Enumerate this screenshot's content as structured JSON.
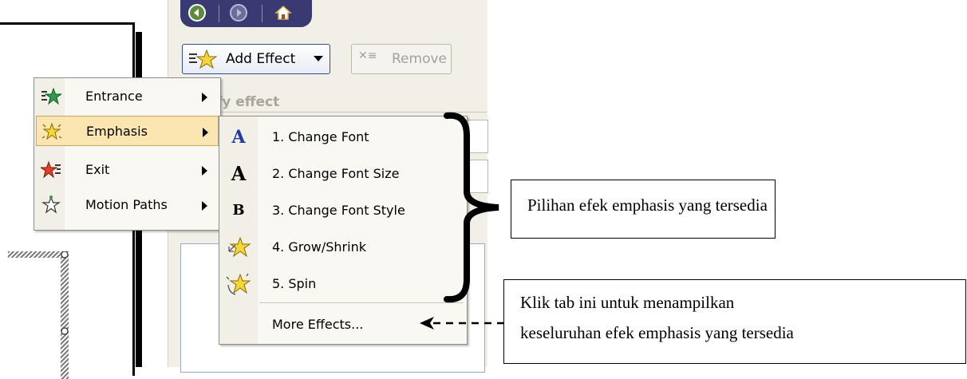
{
  "nav": {
    "back_icon": "back-arrow-icon",
    "forward_icon": "forward-arrow-icon",
    "home_icon": "home-icon"
  },
  "toolbar": {
    "add_effect_label": "Add Effect",
    "remove_label": "Remove"
  },
  "section": {
    "modify_effect_label": "ify effect"
  },
  "menu_main": {
    "items": [
      {
        "label": "Entrance",
        "icon": "entrance-star-icon"
      },
      {
        "label": "Emphasis",
        "icon": "emphasis-star-icon"
      },
      {
        "label": "Exit",
        "icon": "exit-star-icon"
      },
      {
        "label": "Motion Paths",
        "icon": "motion-paths-star-icon"
      }
    ]
  },
  "menu_emphasis": {
    "items": [
      {
        "label": "1. Change Font",
        "icon": "A"
      },
      {
        "label": "2. Change Font Size",
        "icon": "A"
      },
      {
        "label": "3. Change Font Style",
        "icon": "B"
      },
      {
        "label": "4. Grow/Shrink",
        "icon": "grow-shrink-star-icon"
      },
      {
        "label": "5. Spin",
        "icon": "spin-star-icon"
      }
    ],
    "more_effects_label": "More Effects..."
  },
  "annotations": {
    "callout_1": "Pilihan efek emphasis yang tersedia",
    "callout_2_line_1": "Klik tab ini untuk menampilkan",
    "callout_2_line_2": "keseluruhan efek emphasis yang tersedia"
  },
  "colors": {
    "menu_highlight": "#fbe6b2",
    "task_pane_bg": "#f1efe6",
    "nav_bar": "#3a3a72",
    "icon_blue": "#1e3aa8"
  }
}
